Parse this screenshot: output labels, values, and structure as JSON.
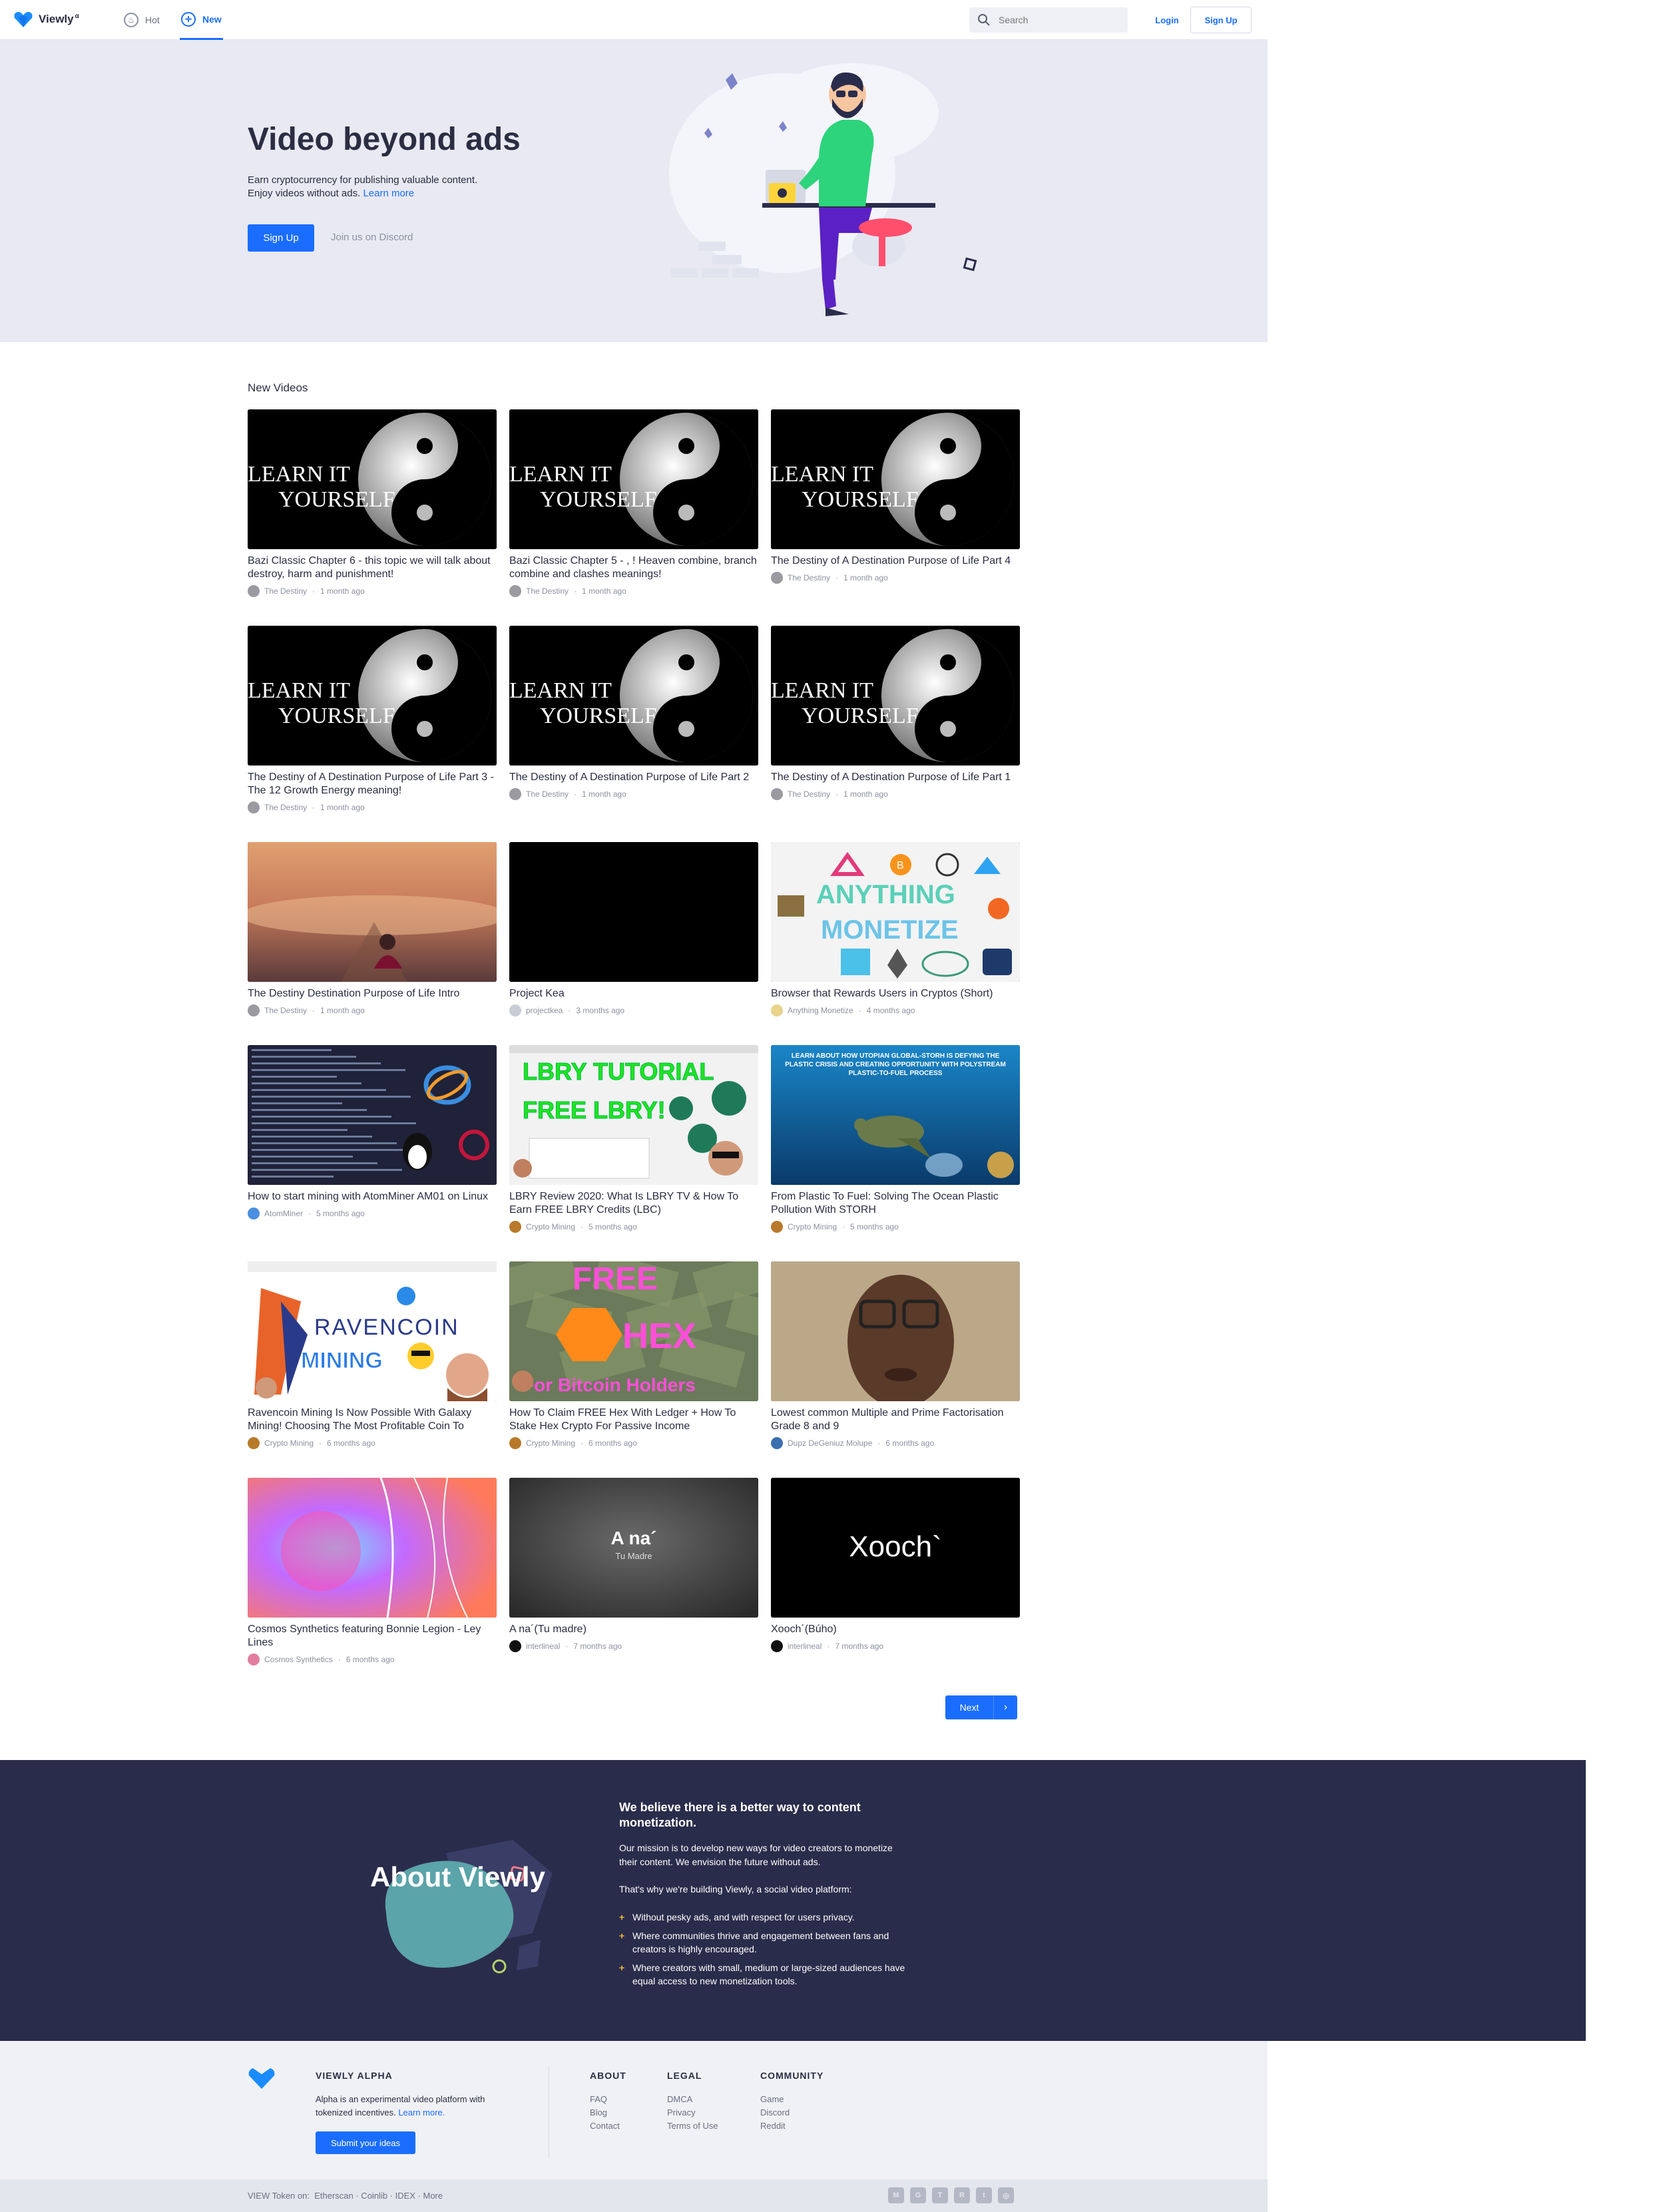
{
  "navbar": {
    "logo_text": "Viewly",
    "logo_sup": "α",
    "tabs": [
      {
        "label": "Hot",
        "icon": "flame-icon"
      },
      {
        "label": "New",
        "icon": "compass-icon"
      }
    ],
    "search_placeholder": "Search",
    "login_label": "Login",
    "signup_label": "Sign Up"
  },
  "hero": {
    "title": "Video beyond ads",
    "line1": "Earn cryptocurrency for publishing valuable content.",
    "line2": "Enjoy videos without ads.",
    "learn_more": "Learn more",
    "signup_label": "Sign Up",
    "discord_label": "Join us on Discord"
  },
  "section_title": "New Videos",
  "videos": [
    {
      "title": "Bazi Classic Chapter 6 - this topic we will talk about destroy, harm and punishment!",
      "channel": "The Destiny",
      "age": "1 month ago",
      "thumb": "yinyang"
    },
    {
      "title": "Bazi Classic Chapter 5 - , ! Heaven combine, branch combine and clashes meanings!",
      "channel": "The Destiny",
      "age": "1 month ago",
      "thumb": "yinyang"
    },
    {
      "title": "The Destiny of A Destination Purpose of Life Part 4",
      "channel": "The Destiny",
      "age": "1 month ago",
      "thumb": "yinyang"
    },
    {
      "title": "The Destiny of A Destination Purpose of Life Part 3 - The 12 Growth Energy meaning!",
      "channel": "The Destiny",
      "age": "1 month ago",
      "thumb": "yinyang"
    },
    {
      "title": "The Destiny of A Destination Purpose of Life Part 2",
      "channel": "The Destiny",
      "age": "1 month ago",
      "thumb": "yinyang"
    },
    {
      "title": "The Destiny of A Destination Purpose of Life Part 1",
      "channel": "The Destiny",
      "age": "1 month ago",
      "thumb": "yinyang"
    },
    {
      "title": "The Destiny Destination Purpose of Life Intro",
      "channel": "The Destiny",
      "age": "1 month ago",
      "thumb": "sunset"
    },
    {
      "title": "Project Kea",
      "channel": "projectkea",
      "age": "3 months ago",
      "thumb": "black"
    },
    {
      "title": "Browser that Rewards Users in Cryptos (Short)",
      "channel": "Anything Monetize",
      "age": "4 months ago",
      "thumb": "monetize"
    },
    {
      "title": "How to start mining with AtomMiner AM01 on Linux",
      "channel": "AtomMiner",
      "age": "5 months ago",
      "thumb": "terminal"
    },
    {
      "title": "LBRY Review 2020: What Is LBRY TV & How To Earn FREE LBRY Credits (LBC)",
      "channel": "Crypto Mining",
      "age": "5 months ago",
      "thumb": "lbry"
    },
    {
      "title": "From Plastic To Fuel: Solving The Ocean Plastic Pollution With STORH",
      "channel": "Crypto Mining",
      "age": "5 months ago",
      "thumb": "ocean"
    },
    {
      "title": "Ravencoin Mining Is Now Possible With Galaxy Mining! Choosing The Most Profitable Coin To",
      "channel": "Crypto Mining",
      "age": "6 months ago",
      "thumb": "raven"
    },
    {
      "title": "How To Claim FREE Hex With Ledger + How To Stake Hex Crypto For Passive Income",
      "channel": "Crypto Mining",
      "age": "6 months ago",
      "thumb": "hex"
    },
    {
      "title": "Lowest common Multiple and Prime Factorisation Grade 8 and 9",
      "channel": "Dupz DeGeniuz Molupe",
      "age": "6 months ago",
      "thumb": "face"
    },
    {
      "title": "Cosmos Synthetics featuring Bonnie Legion - Ley Lines",
      "channel": "Cosmos Synthetics",
      "age": "6 months ago",
      "thumb": "cosmos"
    },
    {
      "title": "A na´(Tu madre)",
      "channel": "interlineal",
      "age": "7 months ago",
      "thumb": "ana"
    },
    {
      "title": "Xooch´(Búho)",
      "channel": "interlineal",
      "age": "7 months ago",
      "thumb": "xooch"
    }
  ],
  "thumb_text": {
    "learn_line1": "LEARN IT",
    "learn_line2": "YOURSELF",
    "monetize_line1": "ANYTHING",
    "monetize_line2": "MONETIZE",
    "lbry_line1": "LBRY TUTORIAL",
    "lbry_line2": "FREE LBRY!",
    "ocean_text": "LEARN ABOUT HOW UTOPIAN GLOBAL-STORH IS DEFYING THE PLASTIC CRISIS AND CREATING OPPORTUNITY WITH POLYSTREAM PLASTIC-TO-FUEL PROCESS",
    "raven_line1": "RAVENCOIN",
    "raven_line2": "MINING",
    "hex_line1": "FREE",
    "hex_line2": "HEX",
    "hex_line3": "For Bitcoin Holders",
    "ana_title": "A na´",
    "ana_sub": "Tu Madre",
    "xooch_title": "Xooch`"
  },
  "pagination": {
    "next_label": "Next"
  },
  "about": {
    "title": "About Viewly",
    "heading": "We believe there is a better way to content monetization.",
    "p1": "Our mission is to develop new ways for video creators to monetize their content. We envision the future without ads.",
    "p2": "That's why we're building Viewly, a social video platform:",
    "list": [
      "Without pesky ads, and with respect for users privacy.",
      "Where communities thrive and engagement between fans and creators is highly encouraged.",
      "Where creators with small, medium or large-sized audiences have equal access to new monetization tools."
    ]
  },
  "footer": {
    "brand": "VIEWLY ALPHA",
    "desc": "Alpha is an experimental video platform with tokenized incentives.",
    "learn_more": "Learn more.",
    "submit_label": "Submit your ideas",
    "columns": [
      {
        "title": "ABOUT",
        "links": [
          "FAQ",
          "Blog",
          "Contact"
        ]
      },
      {
        "title": "LEGAL",
        "links": [
          "DMCA",
          "Privacy",
          "Terms of Use"
        ]
      },
      {
        "title": "COMMUNITY",
        "links": [
          "Game",
          "Discord",
          "Reddit"
        ]
      }
    ],
    "token_label": "VIEW Token on:",
    "token_links": "Etherscan · Coinlib · IDEX · More",
    "socials": [
      "medium-icon",
      "github-icon",
      "telegram-icon",
      "reddit-icon",
      "twitter-icon",
      "instagram-icon"
    ]
  },
  "colors": {
    "accent": "#1a6dff",
    "about_bg": "#2a2c4b",
    "hero_bg": "#e8e9f2"
  }
}
